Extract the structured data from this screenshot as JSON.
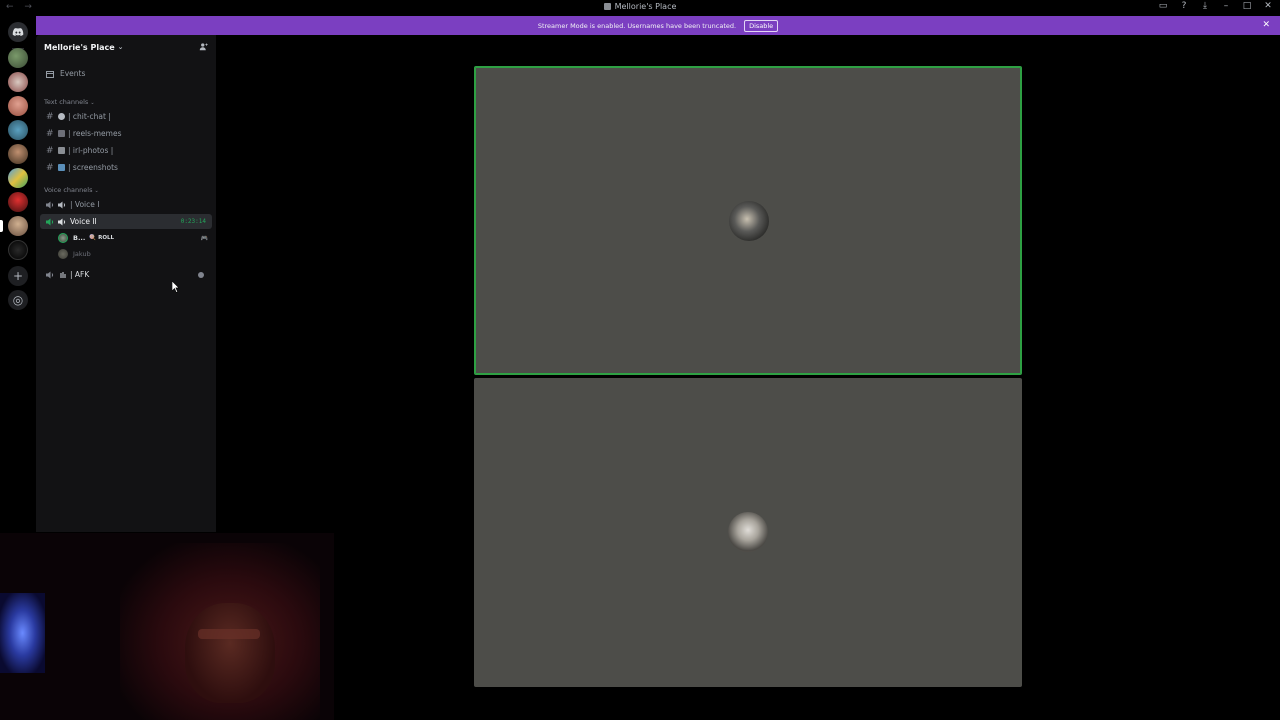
{
  "window": {
    "title": "Mellorie's Place",
    "nav_arrows": "← →",
    "buttons": [
      "▭",
      "?",
      "⤓",
      "–",
      "□",
      "✕"
    ]
  },
  "banner": {
    "text": "Streamer Mode is enabled. Usernames have been truncated.",
    "disable_label": "Disable",
    "close": "✕",
    "color": "#7b3fc1"
  },
  "server": {
    "name": "Mellorie's Place",
    "chevron": "⌄"
  },
  "sidebar": {
    "events_label": "Events",
    "text_category": "Text channels",
    "text_channels": [
      {
        "name": "| chit-chat |",
        "emoji_color": "#b5bac1"
      },
      {
        "name": "| reels-memes",
        "emoji_color": "#6d6f78"
      },
      {
        "name": "| irl-photos |",
        "emoji_color": "#8a8e94"
      },
      {
        "name": "| screenshots",
        "emoji_color": "#5b8fb9"
      }
    ],
    "voice_category": "Voice channels",
    "voice_channels": [
      {
        "name": "| Voice I"
      },
      {
        "name": "Voice II",
        "timer": "0:23:14",
        "active": true
      },
      {
        "name": "| AFK"
      }
    ],
    "voice_users": [
      {
        "name": "B...",
        "tag": "🍭 ROLL",
        "control": "🎮"
      },
      {
        "name": "Jakub"
      }
    ]
  },
  "accent_colors": {
    "speaking": "#2ea043",
    "voice_connected": "#23a55a"
  }
}
